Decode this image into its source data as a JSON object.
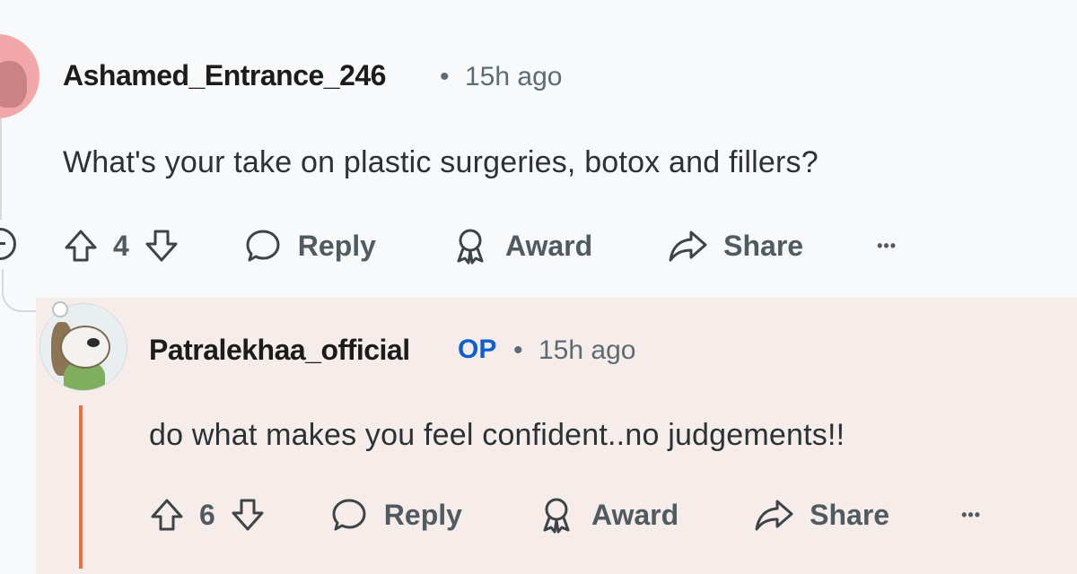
{
  "parent_comment": {
    "author": "Ashamed_Entrance_246",
    "separator": "•",
    "time": "15h ago",
    "body": "What's your take on plastic surgeries, botox and fillers?",
    "votes": "4",
    "actions": {
      "reply": "Reply",
      "award": "Award",
      "share": "Share",
      "more": "•••"
    }
  },
  "reply_comment": {
    "author": "Patralekhaa_official",
    "op_badge": "OP",
    "separator": "•",
    "time": "15h ago",
    "body": "do what makes you feel confident..no judgements!!",
    "votes": "6",
    "actions": {
      "reply": "Reply",
      "award": "Award",
      "share": "Share",
      "more": "•••"
    }
  },
  "colors": {
    "background": "#f7f9fa",
    "reply_highlight": "#f6ece9",
    "op_accent": "#0b5fd1",
    "thread_accent": "#e8703c"
  }
}
